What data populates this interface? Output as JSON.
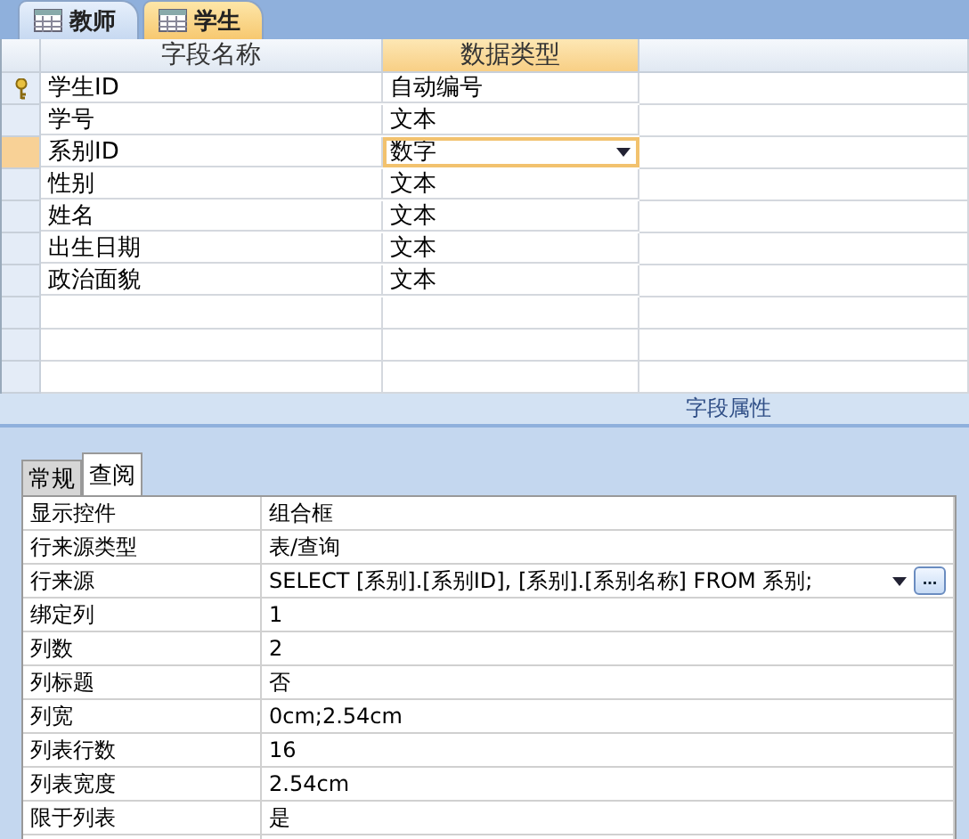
{
  "document_tabs": [
    {
      "label": "教师",
      "selected": false
    },
    {
      "label": "学生",
      "selected": true
    }
  ],
  "field_grid": {
    "columns": [
      "字段名称",
      "数据类型"
    ],
    "rows": [
      {
        "name": "学生ID",
        "type": "自动编号",
        "primary_key": true,
        "selected": false
      },
      {
        "name": "学号",
        "type": "文本",
        "primary_key": false,
        "selected": false
      },
      {
        "name": "系别ID",
        "type": "数字",
        "primary_key": false,
        "selected": true
      },
      {
        "name": "性别",
        "type": "文本",
        "primary_key": false,
        "selected": false
      },
      {
        "name": "姓名",
        "type": "文本",
        "primary_key": false,
        "selected": false
      },
      {
        "name": "出生日期",
        "type": "文本",
        "primary_key": false,
        "selected": false
      },
      {
        "name": "政治面貌",
        "type": "文本",
        "primary_key": false,
        "selected": false
      }
    ]
  },
  "properties_panel": {
    "title": "字段属性",
    "tabs": [
      {
        "label": "常规",
        "selected": false
      },
      {
        "label": "查阅",
        "selected": true
      }
    ],
    "rows": [
      {
        "kind": "text",
        "label": "显示控件",
        "value": "组合框"
      },
      {
        "kind": "text",
        "label": "行来源类型",
        "value": "表/查询"
      },
      {
        "kind": "builder",
        "label": "行来源",
        "value": "SELECT [系别].[系别ID], [系别].[系别名称] FROM 系别;",
        "button": "..."
      },
      {
        "kind": "text",
        "label": "绑定列",
        "value": "1"
      },
      {
        "kind": "text",
        "label": "列数",
        "value": "2"
      },
      {
        "kind": "text",
        "label": "列标题",
        "value": "否"
      },
      {
        "kind": "text",
        "label": "列宽",
        "value": "0cm;2.54cm"
      },
      {
        "kind": "text",
        "label": "列表行数",
        "value": "16"
      },
      {
        "kind": "text",
        "label": "列表宽度",
        "value": "2.54cm"
      },
      {
        "kind": "text",
        "label": "限于列表",
        "value": "是"
      }
    ]
  }
}
